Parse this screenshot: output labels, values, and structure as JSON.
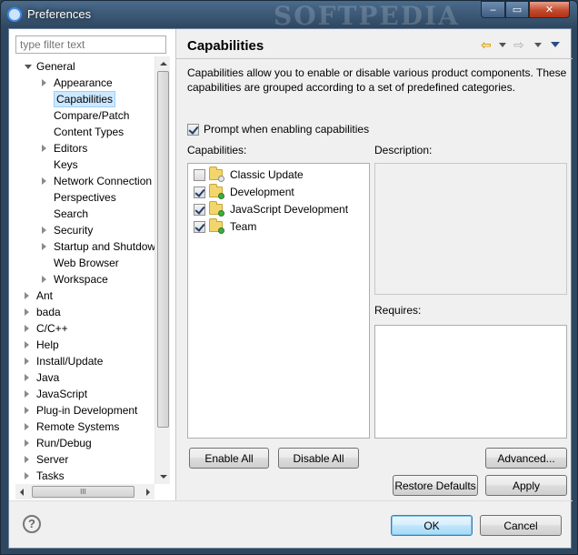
{
  "window": {
    "title": "Preferences",
    "watermark": "SOFTPEDIA",
    "min_glyph": "–",
    "max_glyph": "▭",
    "close_glyph": "✕"
  },
  "filter": {
    "placeholder": "type filter text"
  },
  "tree": [
    {
      "label": "General",
      "expander": "open",
      "level": 0
    },
    {
      "label": "Appearance",
      "expander": "closed",
      "level": 1
    },
    {
      "label": "Capabilities",
      "expander": "none",
      "level": 1,
      "selected": true
    },
    {
      "label": "Compare/Patch",
      "expander": "none",
      "level": 1
    },
    {
      "label": "Content Types",
      "expander": "none",
      "level": 1
    },
    {
      "label": "Editors",
      "expander": "closed",
      "level": 1
    },
    {
      "label": "Keys",
      "expander": "none",
      "level": 1
    },
    {
      "label": "Network Connection",
      "expander": "closed",
      "level": 1
    },
    {
      "label": "Perspectives",
      "expander": "none",
      "level": 1
    },
    {
      "label": "Search",
      "expander": "none",
      "level": 1
    },
    {
      "label": "Security",
      "expander": "closed",
      "level": 1
    },
    {
      "label": "Startup and Shutdown",
      "expander": "closed",
      "level": 1
    },
    {
      "label": "Web Browser",
      "expander": "none",
      "level": 1
    },
    {
      "label": "Workspace",
      "expander": "closed",
      "level": 1
    },
    {
      "label": "Ant",
      "expander": "closed",
      "level": 0
    },
    {
      "label": "bada",
      "expander": "closed",
      "level": 0
    },
    {
      "label": "C/C++",
      "expander": "closed",
      "level": 0
    },
    {
      "label": "Help",
      "expander": "closed",
      "level": 0
    },
    {
      "label": "Install/Update",
      "expander": "closed",
      "level": 0
    },
    {
      "label": "Java",
      "expander": "closed",
      "level": 0
    },
    {
      "label": "JavaScript",
      "expander": "closed",
      "level": 0
    },
    {
      "label": "Plug-in Development",
      "expander": "closed",
      "level": 0
    },
    {
      "label": "Remote Systems",
      "expander": "closed",
      "level": 0
    },
    {
      "label": "Run/Debug",
      "expander": "closed",
      "level": 0
    },
    {
      "label": "Server",
      "expander": "closed",
      "level": 0
    },
    {
      "label": "Tasks",
      "expander": "closed",
      "level": 0
    }
  ],
  "hscroll": {
    "thumb_grip": "III"
  },
  "page": {
    "title": "Capabilities",
    "nav_back": "⇦",
    "nav_forward": "⇨",
    "description": "Capabilities allow you to enable or disable various product components.  These capabilities are grouped according to a set of predefined categories.",
    "prompt_label": "Prompt when enabling capabilities",
    "prompt_checked": true,
    "capabilities_label": "Capabilities:",
    "description_label": "Description:",
    "requires_label": "Requires:",
    "capabilities": [
      {
        "label": "Classic Update",
        "checked": false
      },
      {
        "label": "Development",
        "checked": true
      },
      {
        "label": "JavaScript Development",
        "checked": true
      },
      {
        "label": "Team",
        "checked": true
      }
    ],
    "enable_all": "Enable All",
    "disable_all": "Disable All",
    "advanced": "Advanced...",
    "restore_defaults": "Restore Defaults",
    "apply": "Apply"
  },
  "footer": {
    "help_glyph": "?",
    "ok": "OK",
    "cancel": "Cancel"
  }
}
